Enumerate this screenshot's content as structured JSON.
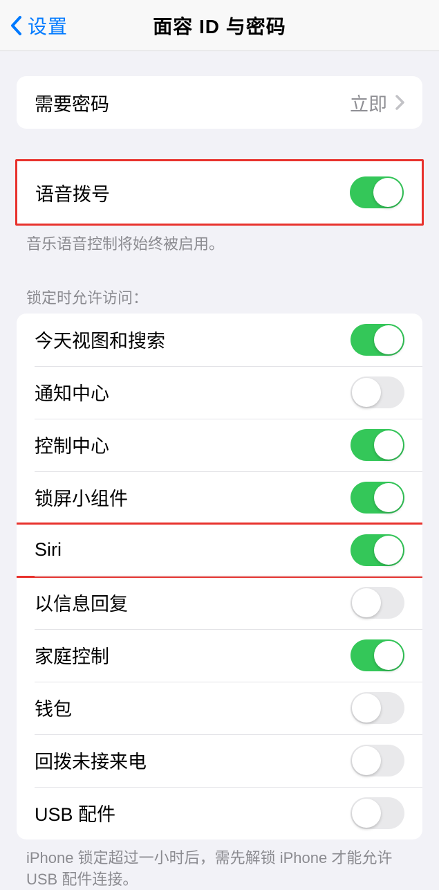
{
  "nav": {
    "back_label": "设置",
    "title": "面容 ID 与密码"
  },
  "passcode": {
    "label": "需要密码",
    "value": "立即"
  },
  "voice_dial": {
    "label": "语音拨号",
    "enabled": true,
    "footer": "音乐语音控制将始终被启用。"
  },
  "lock_section": {
    "header": "锁定时允许访问：",
    "items": [
      {
        "label": "今天视图和搜索",
        "enabled": true,
        "highlighted": false
      },
      {
        "label": "通知中心",
        "enabled": false,
        "highlighted": false
      },
      {
        "label": "控制中心",
        "enabled": true,
        "highlighted": false
      },
      {
        "label": "锁屏小组件",
        "enabled": true,
        "highlighted": false
      },
      {
        "label": "Siri",
        "enabled": true,
        "highlighted": true
      },
      {
        "label": "以信息回复",
        "enabled": false,
        "highlighted": false
      },
      {
        "label": "家庭控制",
        "enabled": true,
        "highlighted": false
      },
      {
        "label": "钱包",
        "enabled": false,
        "highlighted": false
      },
      {
        "label": "回拨未接来电",
        "enabled": false,
        "highlighted": false
      },
      {
        "label": "USB 配件",
        "enabled": false,
        "highlighted": false
      }
    ],
    "footer": "iPhone 锁定超过一小时后，需先解锁 iPhone 才能允许 USB 配件连接。"
  }
}
